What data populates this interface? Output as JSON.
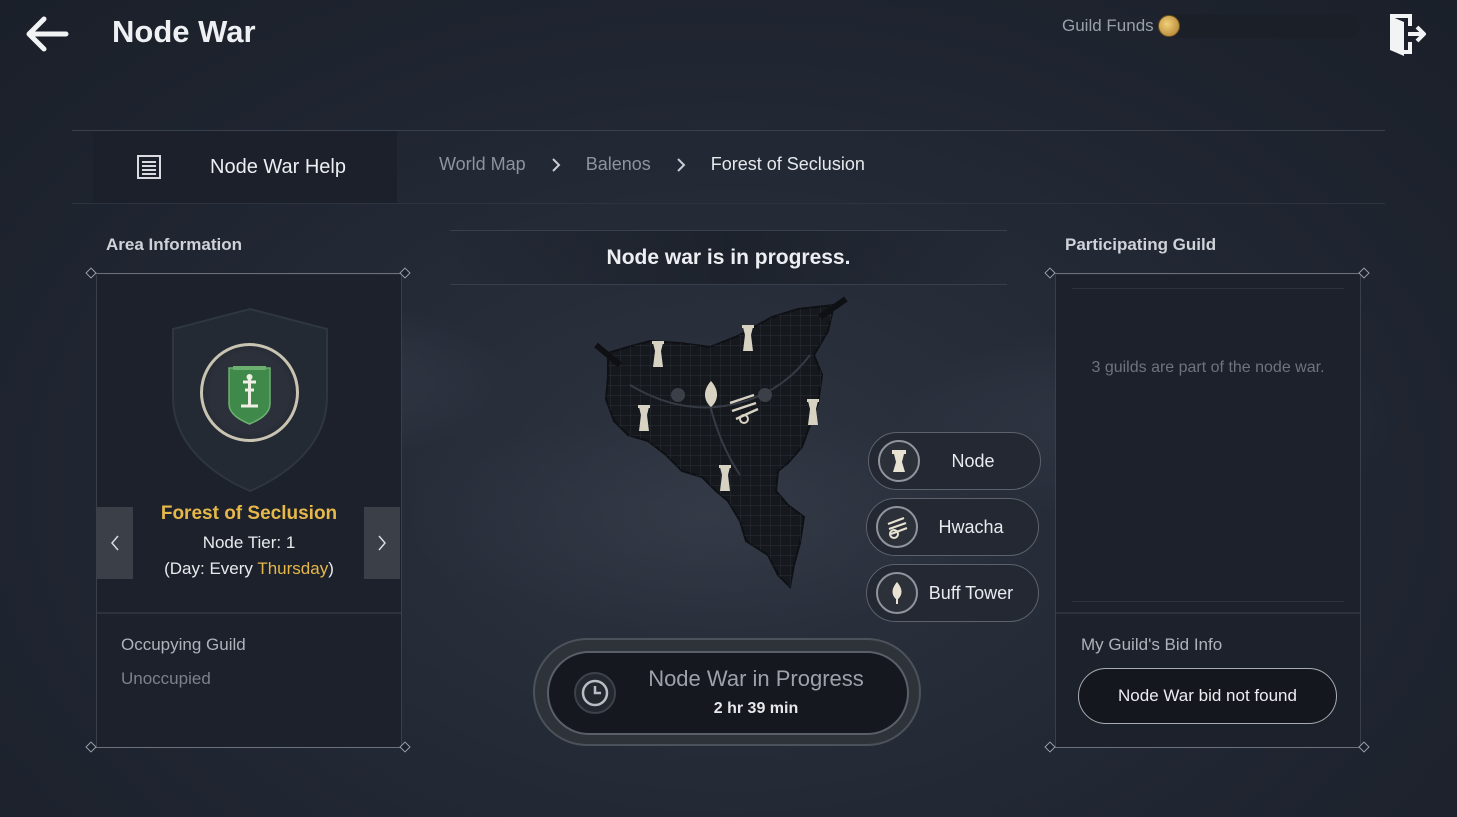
{
  "header": {
    "title": "Node War",
    "funds_label": "Guild Funds"
  },
  "help": {
    "label": "Node War Help"
  },
  "breadcrumb": [
    "World Map",
    "Balenos",
    "Forest of Seclusion"
  ],
  "area": {
    "section_label": "Area Information",
    "name": "Forest of Seclusion",
    "tier": "Node Tier: 1",
    "day_prefix": "(Day: Every ",
    "day": "Thursday",
    "day_suffix": ")",
    "occupying_label": "Occupying Guild",
    "occupying_value": "Unoccupied"
  },
  "center": {
    "status": "Node war is in progress.",
    "legend": [
      {
        "label": "Node",
        "icon": "tower-icon"
      },
      {
        "label": "Hwacha",
        "icon": "hwacha-icon"
      },
      {
        "label": "Buff Tower",
        "icon": "buff-tower-icon"
      }
    ],
    "progress_title": "Node War in Progress",
    "progress_time": "2 hr 39 min"
  },
  "guild": {
    "section_label": "Participating Guild",
    "message": "3 guilds are part of the node war.",
    "bid_label": "My Guild's Bid Info",
    "bid_button": "Node War bid not found"
  },
  "colors": {
    "accent_gold": "#e6b84a",
    "emblem_green": "#3f8a4a"
  }
}
